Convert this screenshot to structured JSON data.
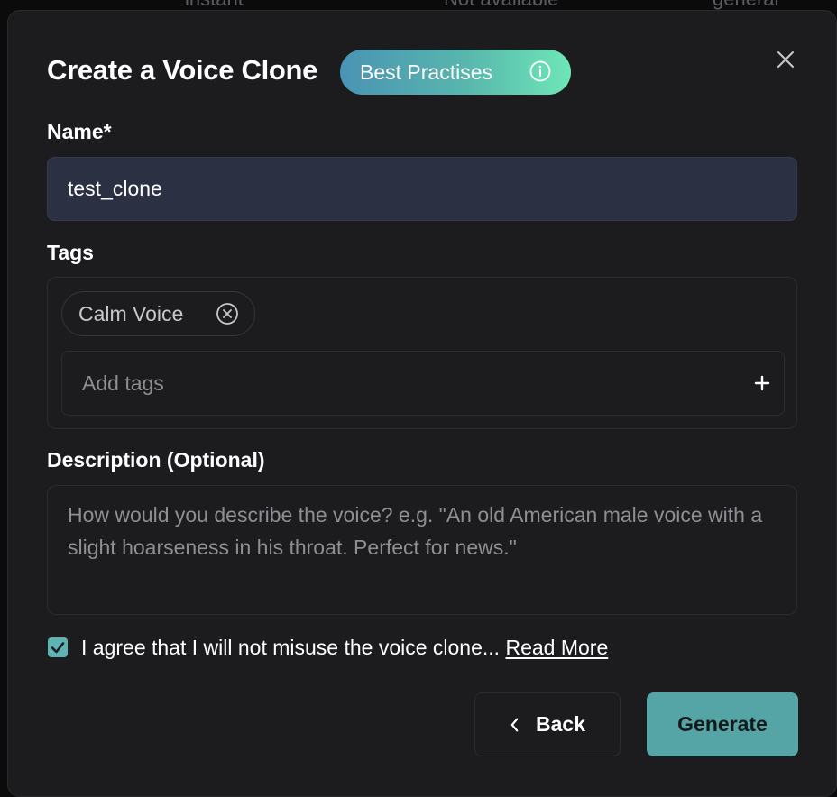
{
  "background_row": {
    "col1": "instant",
    "col2": "Not available",
    "col3": "general"
  },
  "dialog": {
    "title": "Create a Voice Clone",
    "best_practises_label": "Best Practises",
    "close_icon": "close-icon",
    "info_icon": "info-icon"
  },
  "name_field": {
    "label": "Name*",
    "value": "test_clone"
  },
  "tags": {
    "label": "Tags",
    "items": [
      {
        "label": "Calm Voice",
        "remove_icon": "remove-circle-icon"
      }
    ],
    "input_placeholder": "Add tags",
    "add_icon": "plus-icon"
  },
  "description": {
    "label": "Description (Optional)",
    "placeholder": "How would you describe the voice? e.g. \"An old American male voice with a slight hoarseness in his throat. Perfect for news.\"",
    "value": ""
  },
  "agreement": {
    "checked": true,
    "text": "I agree that I will not misuse the voice clone...",
    "link_label": "Read More"
  },
  "footer": {
    "back_label": "Back",
    "generate_label": "Generate"
  },
  "colors": {
    "modal_bg": "#1c1c1f",
    "input_bg": "#2b3142",
    "accent": "#55a5a7",
    "pill_gradient_start": "#4a93b4",
    "pill_gradient_end": "#6ee7b7"
  }
}
